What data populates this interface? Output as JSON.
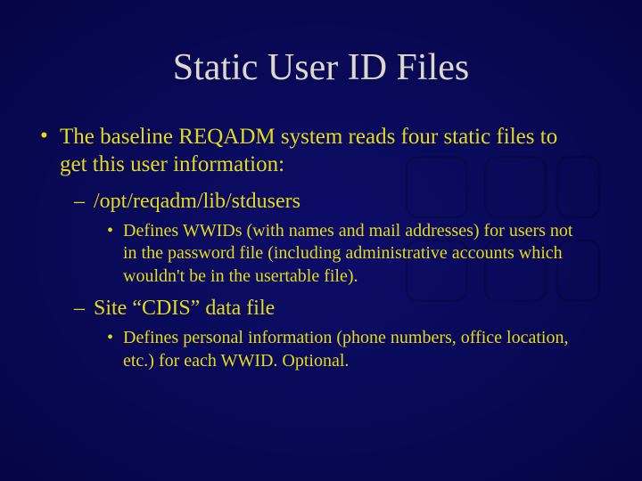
{
  "slide": {
    "title": "Static User ID Files",
    "bullets": [
      {
        "level": 1,
        "marker": "•",
        "text": "The baseline REQADM system reads four static files to get this user information:"
      },
      {
        "level": 2,
        "marker": "–",
        "text": "/opt/reqadm/lib/stdusers"
      },
      {
        "level": 3,
        "marker": "•",
        "text": "Defines WWIDs (with names and mail addresses) for users not in the password file (including administrative accounts which wouldn't be in the usertable file)."
      },
      {
        "level": 2,
        "marker": "–",
        "text": "Site “CDIS” data file"
      },
      {
        "level": 3,
        "marker": "•",
        "text": "Defines personal information (phone numbers, office location, etc.) for each WWID.  Optional."
      }
    ]
  }
}
